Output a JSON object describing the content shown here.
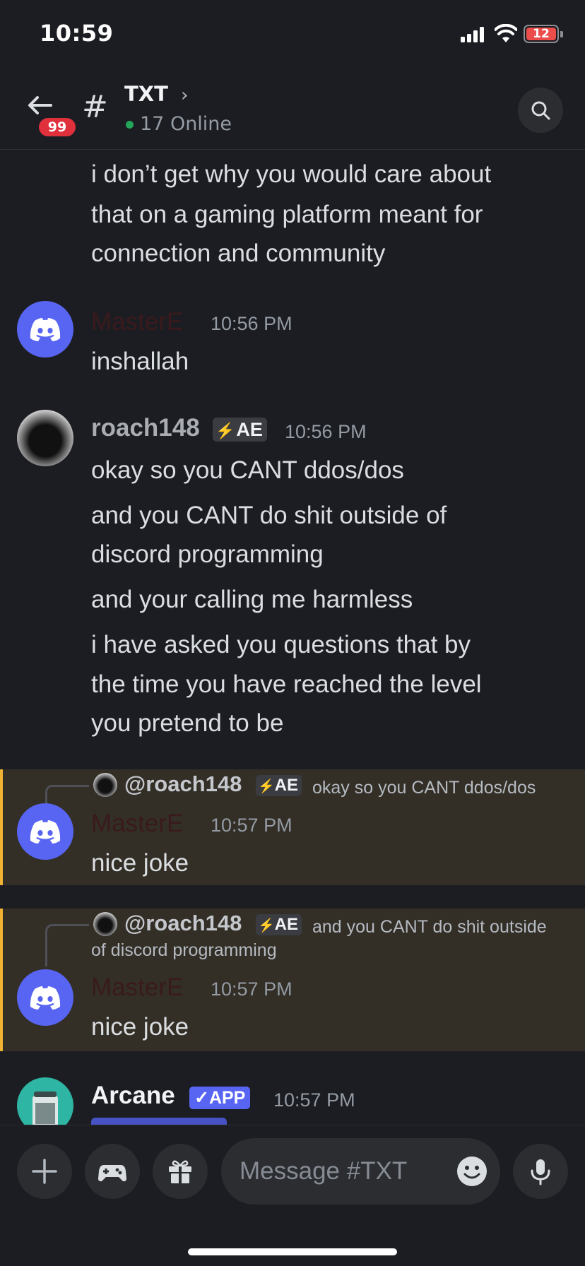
{
  "status_bar": {
    "time": "10:59",
    "battery": "12"
  },
  "header": {
    "back_badge": "99",
    "channel_name": "TXT",
    "online_count": "17 Online"
  },
  "messages": {
    "m0": {
      "lines": [
        "i don’t get why you would care about",
        "that on a gaming platform meant for",
        "connection and community"
      ]
    },
    "m1": {
      "username": "MasterE",
      "username_color": "#3a1a1c",
      "timestamp": "10:56 PM",
      "text": "inshallah"
    },
    "m2": {
      "username": "roach148",
      "tag": "AE",
      "timestamp": "10:56 PM",
      "lines": [
        "okay so you CANT ddos/dos",
        "and you CANT do shit outside of",
        "discord programming",
        "and your calling me harmless",
        "i have asked you questions that by",
        "the time you have reached the level",
        "you pretend to be"
      ]
    },
    "m3": {
      "reply_user": "@roach148",
      "reply_tag": "AE",
      "reply_text": "okay so you CANT ddos/dos",
      "username": "MasterE",
      "timestamp": "10:57 PM",
      "text": "nice joke"
    },
    "m4": {
      "reply_user": "@roach148",
      "reply_tag": "AE",
      "reply_text_1": "and you CANT do shit outside",
      "reply_text_2": "of discord programming",
      "username": "MasterE",
      "timestamp": "10:57 PM",
      "text": "nice joke"
    },
    "m5": {
      "username": "Arcane",
      "badge": "✓APP",
      "timestamp": "10:57 PM"
    }
  },
  "composer": {
    "placeholder": "Message #TXT"
  },
  "colors": {
    "accent": "#5865f2",
    "background": "#1c1d22",
    "reply_highlight": "#332f27",
    "reply_bar": "#f0b232",
    "online": "#23a55a",
    "badge_red": "#e0303c"
  },
  "icons": [
    "back-arrow-icon",
    "hash-icon",
    "chevron-right-icon",
    "search-icon",
    "discord-logo-icon",
    "plus-icon",
    "gamepad-icon",
    "gift-icon",
    "emoji-icon",
    "microphone-icon"
  ]
}
